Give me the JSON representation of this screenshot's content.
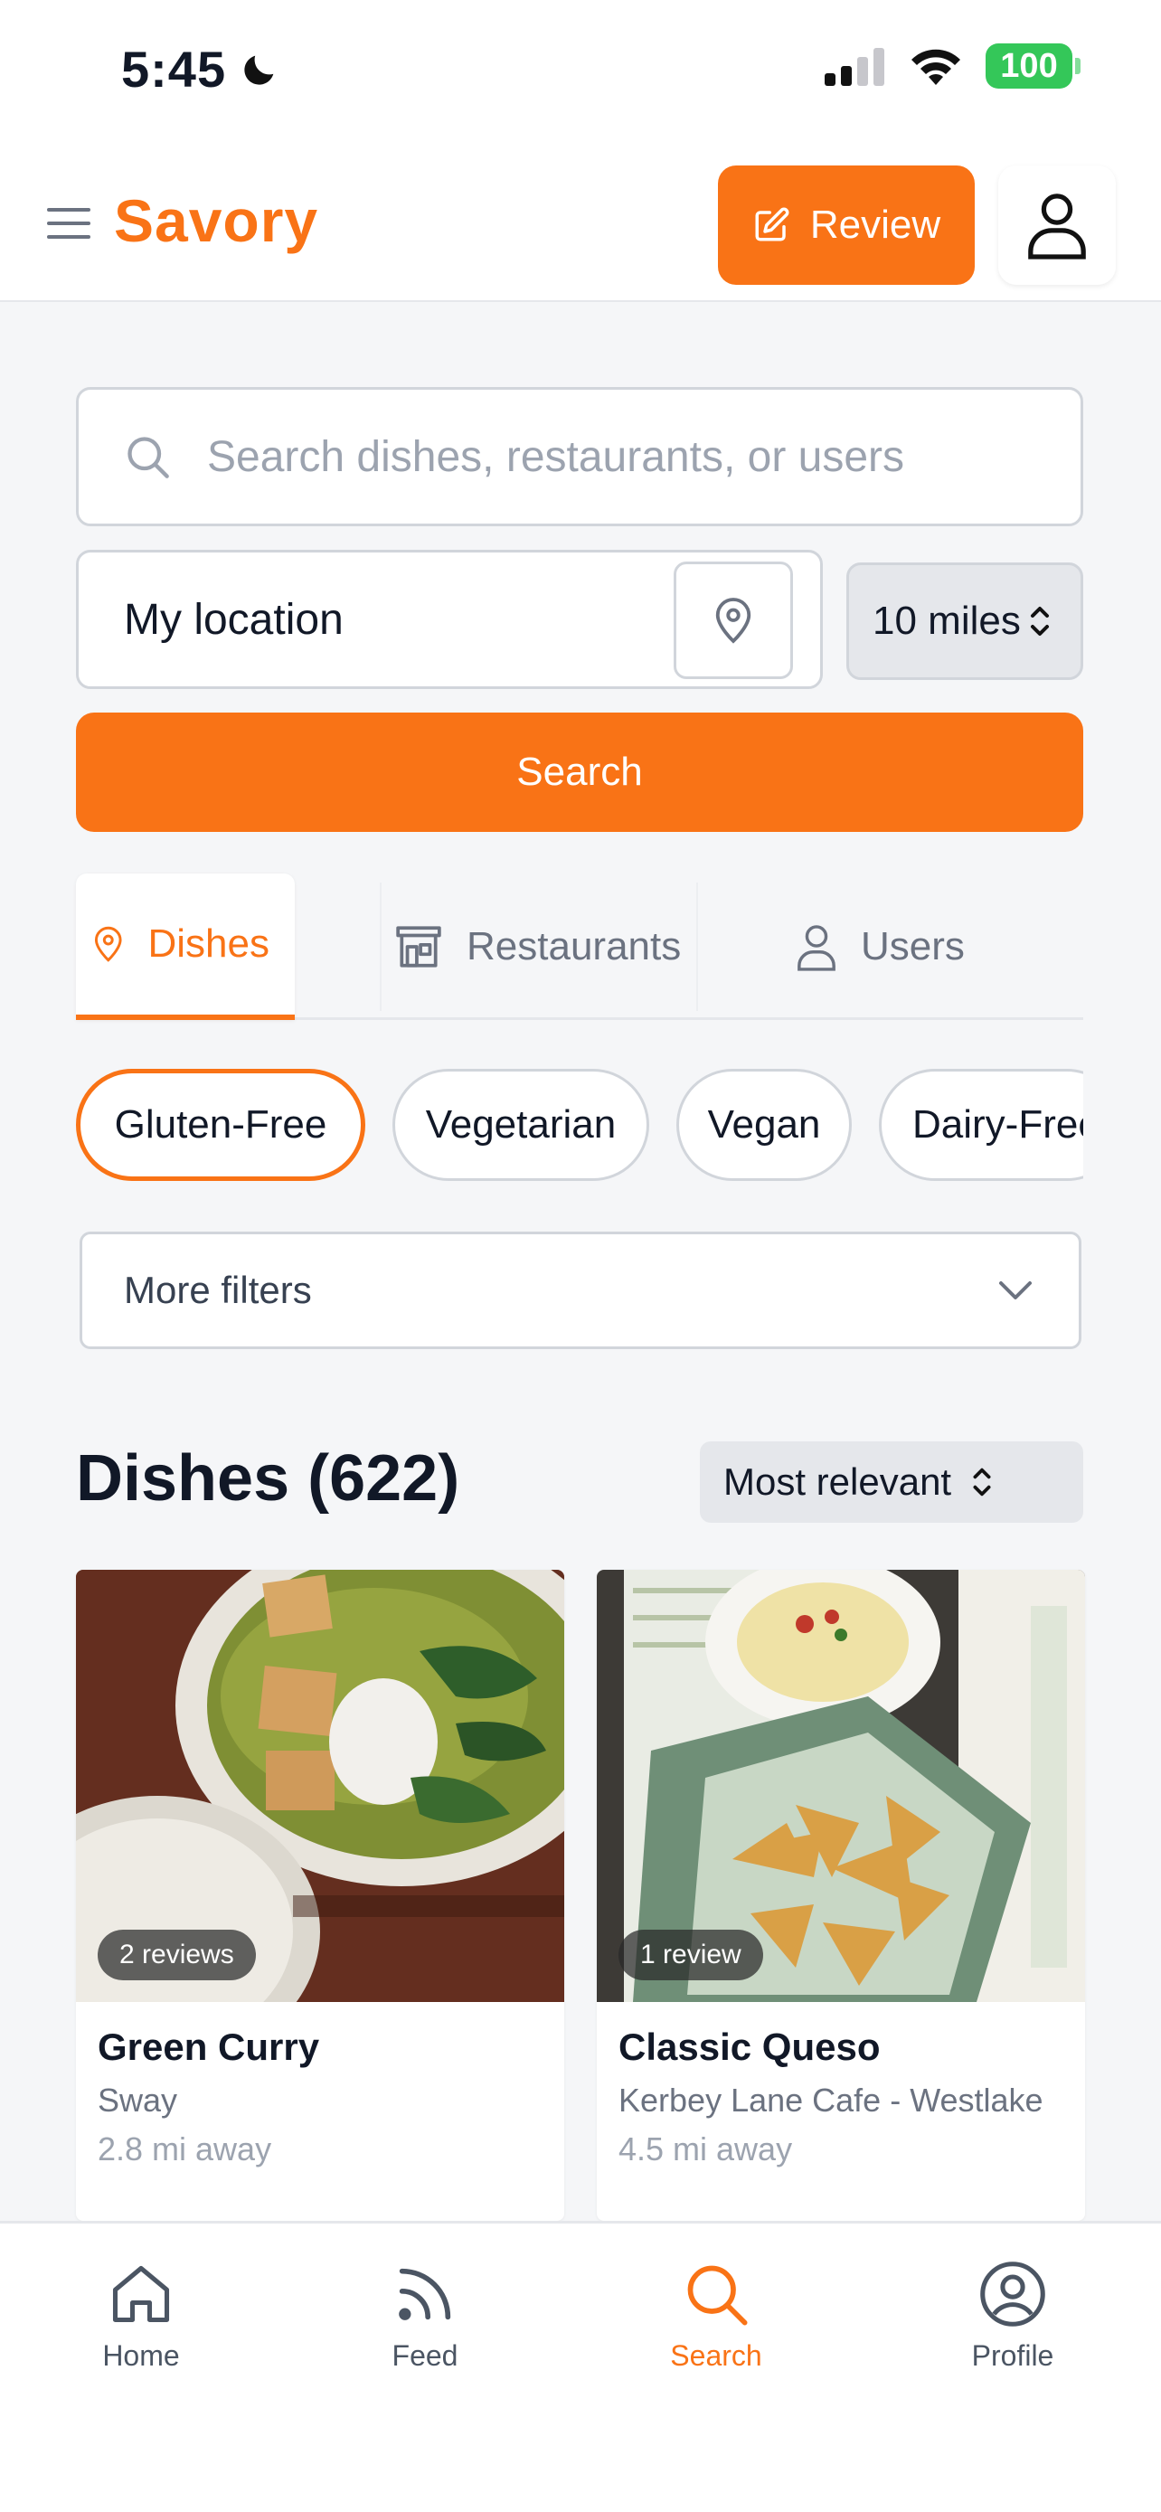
{
  "status_bar": {
    "time": "5:45",
    "battery": "100"
  },
  "header": {
    "logo": "Savory",
    "review_label": "Review"
  },
  "search": {
    "placeholder": "Search dishes, restaurants, or users",
    "location_value": "My location",
    "distance_value": "10 miles",
    "search_label": "Search"
  },
  "tabs": [
    {
      "label": "Dishes",
      "active": true
    },
    {
      "label": "Restaurants",
      "active": false
    },
    {
      "label": "Users",
      "active": false
    }
  ],
  "chips": [
    {
      "label": "Gluten-Free",
      "active": true
    },
    {
      "label": "Vegetarian",
      "active": false
    },
    {
      "label": "Vegan",
      "active": false
    },
    {
      "label": "Dairy-Free",
      "active": false
    }
  ],
  "more_filters_label": "More filters",
  "results": {
    "title": "Dishes (622)",
    "sort_value": "Most relevant"
  },
  "cards": [
    {
      "title": "Green Curry",
      "restaurant": "Sway",
      "distance": "2.8 mi away",
      "reviews": "2 reviews"
    },
    {
      "title": "Classic Queso",
      "restaurant": "Kerbey Lane Cafe - Westlake",
      "distance": "4.5 mi away",
      "reviews": "1 review"
    }
  ],
  "nav": [
    {
      "label": "Home",
      "icon": "home-icon",
      "active": false
    },
    {
      "label": "Feed",
      "icon": "feed-icon",
      "active": false
    },
    {
      "label": "Search",
      "icon": "search-icon",
      "active": true
    },
    {
      "label": "Profile",
      "icon": "profile-icon",
      "active": false
    }
  ],
  "colors": {
    "accent": "#f97316",
    "battery": "#34c759"
  }
}
